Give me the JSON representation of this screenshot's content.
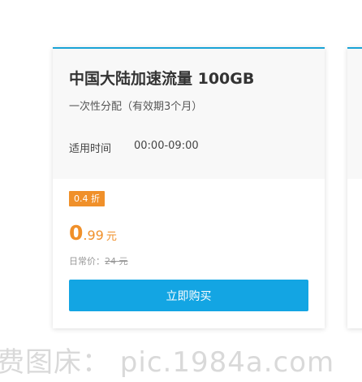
{
  "card": {
    "title": "中国大陆加速流量 100GB",
    "description": "一次性分配（有效期3个月）",
    "time_label": "适用时间",
    "time_value": "00:00-09:00",
    "discount": "0.4 折",
    "price": {
      "integer": "0",
      "decimal": ".99",
      "unit": "元"
    },
    "regular_label": "日常价：",
    "regular_price": "24 元",
    "buy_label": "立即购买"
  },
  "watermark": "费图床：  pic.1984a.com",
  "colors": {
    "accent_blue": "#13a5e3",
    "accent_orange": "#f0902a"
  }
}
